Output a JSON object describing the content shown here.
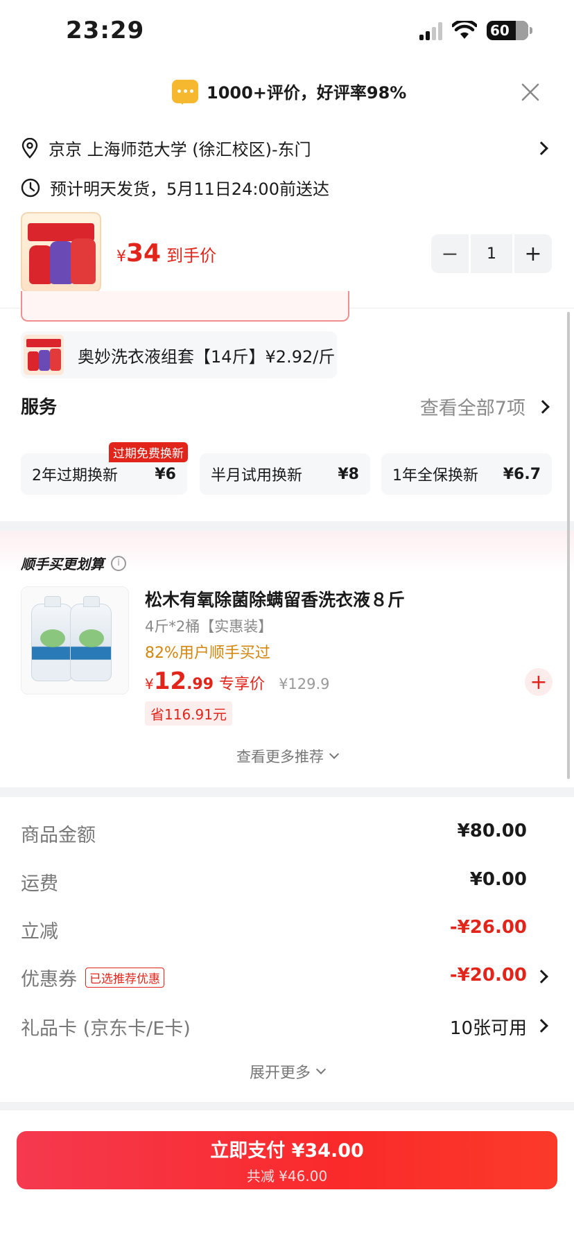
{
  "status_bar": {
    "time": "23:29",
    "battery": "60"
  },
  "review_banner": {
    "text": "1000+评价，好评率98%"
  },
  "address": {
    "location": "京京  上海师范大学 (徐汇校区)-东门",
    "delivery": "预计明天发货，5月11日24:00前送达"
  },
  "product": {
    "currency": "¥",
    "price": "34",
    "price_tag": "到手价",
    "quantity": "1",
    "minus": "−",
    "plus": "+"
  },
  "option": {
    "label": "奥妙洗衣液组套【14斤】¥2.92/斤"
  },
  "services": {
    "title": "服务",
    "view_all": "查看全部7项",
    "badge": "过期免费换新",
    "items": [
      {
        "name": "2年过期换新",
        "price": "¥6"
      },
      {
        "name": "半月试用换新",
        "price": "¥8"
      },
      {
        "name": "1年全保换新",
        "price": "¥6.7"
      }
    ]
  },
  "recommend": {
    "title": "顺手买更划算",
    "info": "i",
    "name": "松木有氧除菌除螨留香洗衣液８斤",
    "spec": "4斤*2桶【实惠装】",
    "buy_rate": "82%用户顺手买过",
    "currency": "¥",
    "price_int": "12",
    "price_dec": ".99",
    "price_tag": "专享价",
    "orig_price": "¥129.9",
    "save": "省116.91元",
    "add": "+",
    "more": "查看更多推荐"
  },
  "summary": {
    "rows": [
      {
        "label": "商品金额",
        "value": "¥80.00"
      },
      {
        "label": "运费",
        "value": "¥0.00"
      },
      {
        "label": "立减",
        "value": "-¥26.00"
      },
      {
        "label": "优惠券",
        "badge": "已选推荐优惠",
        "value": "-¥20.00"
      },
      {
        "label": "礼品卡 (京东卡/E卡)",
        "value": "10张可用"
      }
    ],
    "expand": "展开更多"
  },
  "pay": {
    "main": "立即支付 ¥34.00",
    "sub": "共减 ¥46.00"
  },
  "colors": {
    "accent": "#e1251b",
    "coupon_orange": "#d4860c",
    "gold": "#f5b82e"
  }
}
